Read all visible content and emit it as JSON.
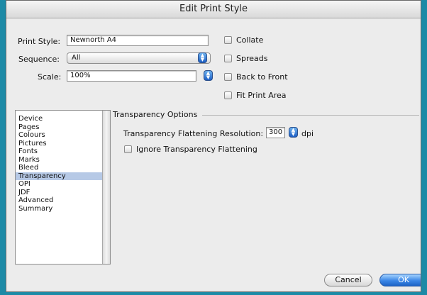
{
  "window": {
    "title": "Edit Print Style"
  },
  "form": {
    "print_style_label": "Print Style:",
    "print_style_value": "Newnorth A4",
    "sequence_label": "Sequence:",
    "sequence_value": "All",
    "scale_label": "Scale:",
    "scale_value": "100%"
  },
  "options": {
    "collate": "Collate",
    "spreads": "Spreads",
    "back_to_front": "Back to Front",
    "fit_print_area": "Fit Print Area"
  },
  "sidebar": {
    "items": [
      {
        "label": "Device",
        "selected": false
      },
      {
        "label": "Pages",
        "selected": false
      },
      {
        "label": "Colours",
        "selected": false
      },
      {
        "label": "Pictures",
        "selected": false
      },
      {
        "label": "Fonts",
        "selected": false
      },
      {
        "label": "Marks",
        "selected": false
      },
      {
        "label": "Bleed",
        "selected": false
      },
      {
        "label": "Transparency",
        "selected": true
      },
      {
        "label": "OPI",
        "selected": false
      },
      {
        "label": "JDF",
        "selected": false
      },
      {
        "label": "Advanced",
        "selected": false
      },
      {
        "label": "Summary",
        "selected": false
      }
    ]
  },
  "transparency": {
    "group_title": "Transparency Options",
    "resolution_label": "Transparency Flattening Resolution:",
    "resolution_value": "300",
    "resolution_unit": "dpi",
    "ignore_label": "Ignore Transparency Flattening"
  },
  "buttons": {
    "cancel": "Cancel",
    "ok": "OK"
  },
  "colors": {
    "desktop": "#1d8aa6",
    "selection": "#b6c9e6",
    "default_button": "#3a86e6"
  }
}
